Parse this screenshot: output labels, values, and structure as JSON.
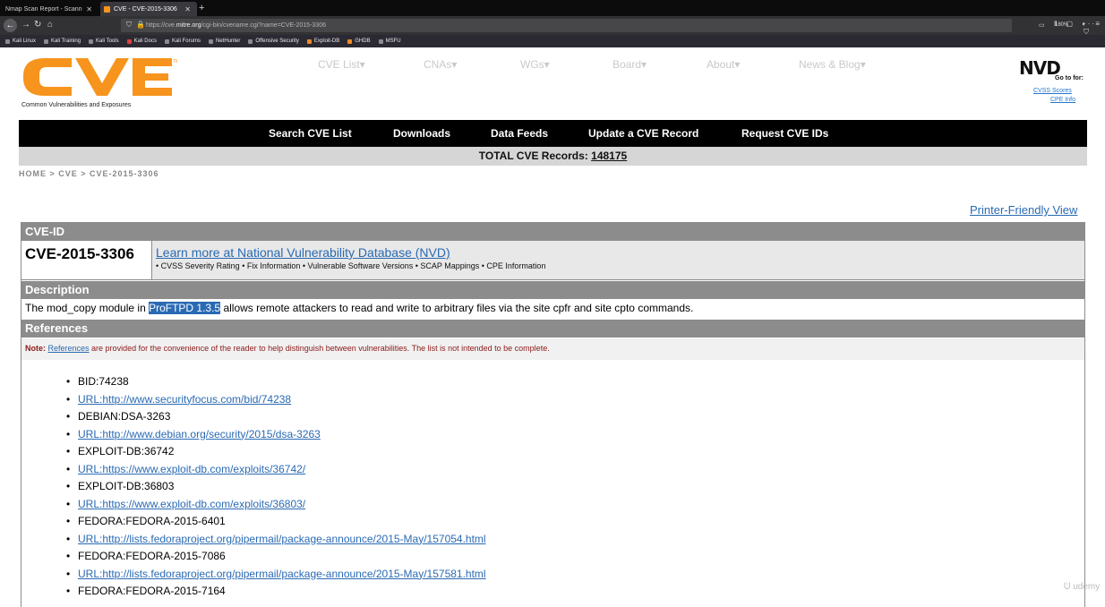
{
  "browser": {
    "tabs": [
      {
        "title": "Nmap Scan Report - Scann",
        "active": false
      },
      {
        "title": "CVE - CVE-2015-3306",
        "active": true
      }
    ],
    "url_prefix": "https://cve.",
    "url_domain": "mitre.org",
    "url_path": "/cgi-bin/cvename.cgi?name=CVE-2015-3306",
    "zoom": "180%",
    "bookmarks": [
      "Kali Linux",
      "Kali Training",
      "Kali Tools",
      "Kali Docs",
      "Kali Forums",
      "NetHunter",
      "Offensive Security",
      "Exploit-DB",
      "GHDB",
      "MSFU"
    ]
  },
  "header": {
    "logo_text": "CVE",
    "logo_subtitle": "Common Vulnerabilities and Exposures",
    "nav": [
      "CVE List▾",
      "CNAs▾",
      "WGs▾",
      "Board▾",
      "About▾",
      "News & Blog▾"
    ],
    "nvd_logo": "NVD",
    "goto_label": "Go to for:",
    "nvd_links": [
      "CVSS Scores",
      "CPE Info"
    ]
  },
  "mainnav": {
    "links": [
      "Search CVE List",
      "Downloads",
      "Data Feeds",
      "Update a CVE Record",
      "Request CVE IDs"
    ],
    "total_label": "TOTAL CVE Records:",
    "total_count": "148175"
  },
  "breadcrumb": "HOME > CVE > CVE-2015-3306",
  "printer_link": "Printer-Friendly View",
  "cve": {
    "id_header": "CVE-ID",
    "id": "CVE-2015-3306",
    "nvd_link": "Learn more at National Vulnerability Database (NVD)",
    "nvd_sub": "• CVSS Severity Rating • Fix Information • Vulnerable Software Versions • SCAP Mappings • CPE Information",
    "desc_header": "Description",
    "desc_before": "The mod_copy module in ",
    "desc_highlight": "ProFTPD 1.3.5",
    "desc_after": " allows remote attackers to read and write to arbitrary files via the site cpfr and site cpto commands.",
    "refs_header": "References",
    "note_label": "Note:",
    "note_link": "References",
    "note_text": " are provided for the convenience of the reader to help distinguish between vulnerabilities. The list is not intended to be complete.",
    "references": [
      {
        "text": "BID:74238",
        "link": false
      },
      {
        "text": "URL:http://www.securityfocus.com/bid/74238",
        "link": true
      },
      {
        "text": "DEBIAN:DSA-3263",
        "link": false
      },
      {
        "text": "URL:http://www.debian.org/security/2015/dsa-3263",
        "link": true
      },
      {
        "text": "EXPLOIT-DB:36742",
        "link": false
      },
      {
        "text": "URL:https://www.exploit-db.com/exploits/36742/",
        "link": true
      },
      {
        "text": "EXPLOIT-DB:36803",
        "link": false
      },
      {
        "text": "URL:https://www.exploit-db.com/exploits/36803/",
        "link": true
      },
      {
        "text": "FEDORA:FEDORA-2015-6401",
        "link": false
      },
      {
        "text": "URL:http://lists.fedoraproject.org/pipermail/package-announce/2015-May/157054.html",
        "link": true
      },
      {
        "text": "FEDORA:FEDORA-2015-7086",
        "link": false
      },
      {
        "text": "URL:http://lists.fedoraproject.org/pipermail/package-announce/2015-May/157581.html",
        "link": true
      },
      {
        "text": "FEDORA:FEDORA-2015-7164",
        "link": false
      }
    ]
  },
  "colors": {
    "logo_orange": "#f7941d",
    "link_blue": "#2a6ab3",
    "section_gray": "#8c8c8c",
    "nav_black": "#000000"
  }
}
